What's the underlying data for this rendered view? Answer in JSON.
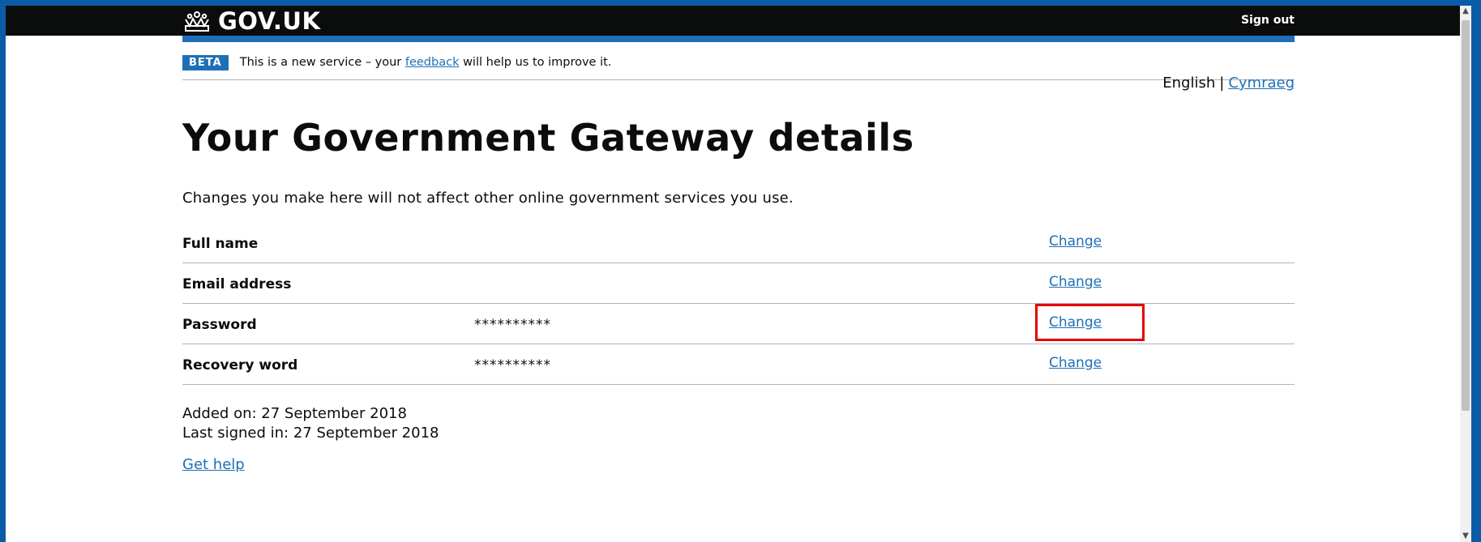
{
  "header": {
    "logo_text": "GOV.UK",
    "logo_icon": "crown-icon",
    "sign_out": "Sign out"
  },
  "phase_banner": {
    "tag": "BETA",
    "text_before": "This is a new service – your",
    "link": "feedback",
    "text_after": "will help us to improve it."
  },
  "language": {
    "current": "English",
    "separator": "|",
    "alternate": "Cymraeg"
  },
  "page": {
    "title": "Your Government Gateway details",
    "intro": "Changes you make here will not affect other online government services you use."
  },
  "details": [
    {
      "key": "Full name",
      "value": "",
      "action": "Change"
    },
    {
      "key": "Email address",
      "value": "",
      "action": "Change"
    },
    {
      "key": "Password",
      "value": "**********",
      "action": "Change"
    },
    {
      "key": "Recovery word",
      "value": "**********",
      "action": "Change"
    }
  ],
  "meta": {
    "added_on": "Added on: 27 September 2018",
    "last_signed_in": "Last signed in: 27 September 2018"
  },
  "help_link": "Get help",
  "colors": {
    "header_bg": "#0b0c0c",
    "brand_blue": "#1d70b8",
    "highlight": "#e60000",
    "frame": "#0b5ca8"
  }
}
